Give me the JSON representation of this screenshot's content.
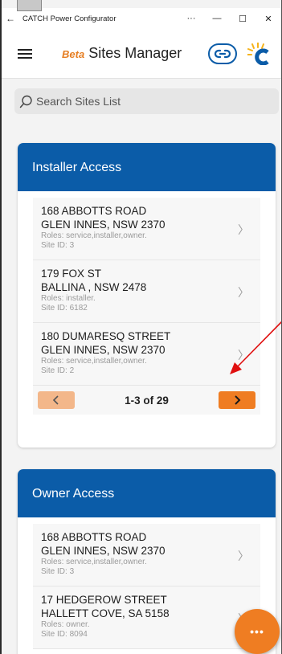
{
  "window": {
    "title": "CATCH Power Configurator",
    "back_glyph": "←",
    "more_glyph": "···",
    "minimize_glyph": "—",
    "maximize_glyph": "☐",
    "close_glyph": "✕"
  },
  "appbar": {
    "beta_label": "Beta",
    "title": "Sites Manager"
  },
  "search": {
    "placeholder": "Search Sites List"
  },
  "installer_access": {
    "title": "Installer Access",
    "sites": [
      {
        "line1": "168 ABBOTTS ROAD",
        "line2": "GLEN INNES, NSW 2370",
        "roles": "Roles: service,installer,owner.",
        "site_id": "Site ID: 3"
      },
      {
        "line1": "179 FOX ST",
        "line2": "BALLINA , NSW 2478",
        "roles": "Roles: installer.",
        "site_id": "Site ID: 6182"
      },
      {
        "line1": "180 DUMARESQ STREET",
        "line2": "GLEN INNES, NSW 2370",
        "roles": "Roles: service,installer,owner.",
        "site_id": "Site ID: 2"
      }
    ],
    "pager": {
      "count": "1-3 of 29"
    }
  },
  "owner_access": {
    "title": "Owner Access",
    "sites": [
      {
        "line1": "168 ABBOTTS ROAD",
        "line2": "GLEN INNES, NSW 2370",
        "roles": "Roles: service,installer,owner.",
        "site_id": "Site ID: 3"
      },
      {
        "line1": "17 HEDGEROW STREET",
        "line2": "HALLETT COVE, SA 5158",
        "roles": "Roles: owner.",
        "site_id": "Site ID: 8094"
      }
    ]
  },
  "fab": {
    "label": "•••"
  },
  "colors": {
    "primary_blue": "#0b5ca8",
    "accent_orange": "#ef7d22",
    "prev_disabled_orange": "#f3b78a",
    "annotation_red": "#e01010"
  },
  "icons": {
    "hamburger": "hamburger-menu-icon",
    "link": "link-chain-icon",
    "logo": "catch-power-logo",
    "search": "search-icon",
    "chevron": "chevron-right-icon",
    "more": "more-horizontal-icon"
  }
}
